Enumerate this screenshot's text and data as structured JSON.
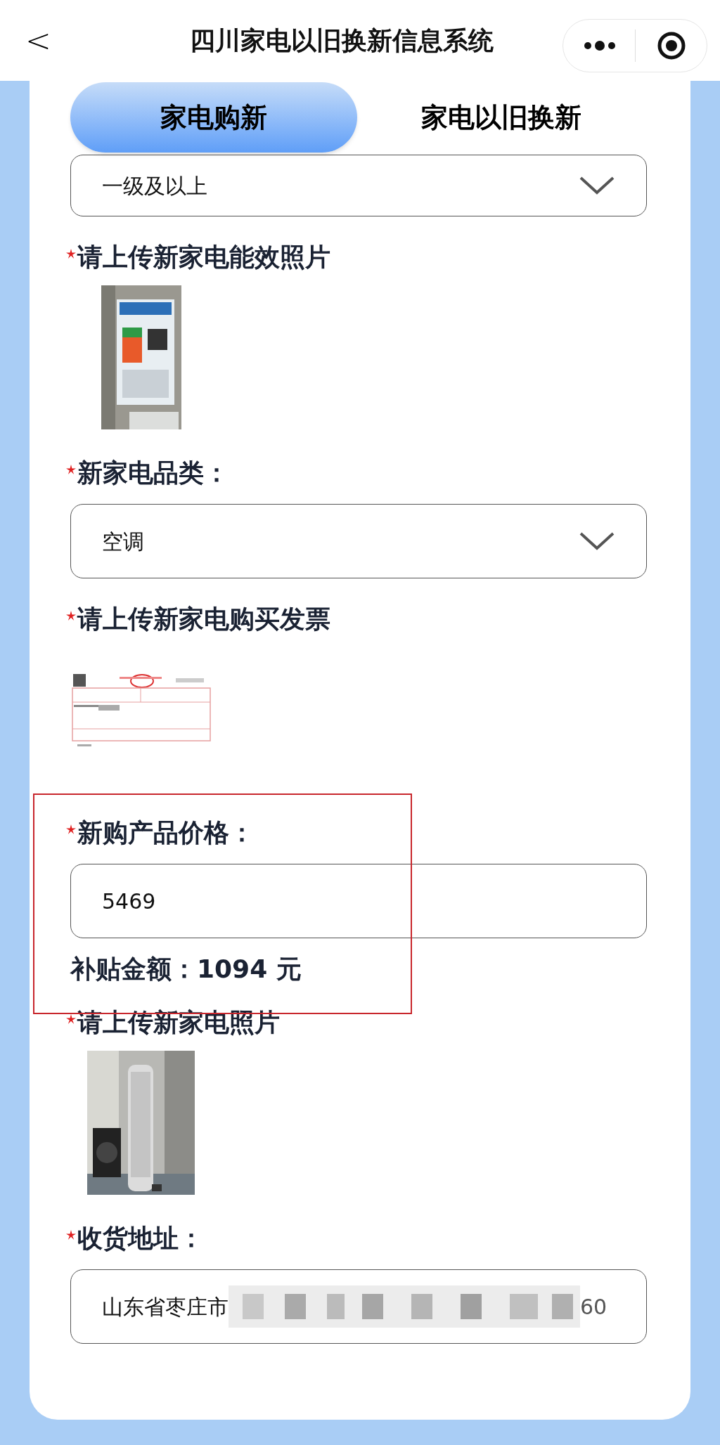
{
  "header": {
    "back": "<",
    "title": "四川家电以旧换新信息系统"
  },
  "tabs": [
    {
      "label": "家电购新",
      "selected": true
    },
    {
      "label": "家电以旧换新",
      "selected": false
    }
  ],
  "fields": [
    {
      "kind": "select",
      "value": "一级及以上"
    },
    {
      "required": true,
      "label": "请上传新家电能效照片"
    },
    {
      "kind": "select",
      "required": true,
      "label": "新家电品类：",
      "value": "空调"
    },
    {
      "required": true,
      "label": "请上传新家电购买发票"
    },
    {
      "kind": "price",
      "required": true,
      "label": "新购产品价格：",
      "value": "5469",
      "subsidy": "补贴金额：1094 元",
      "highlighted": true
    },
    {
      "required": true,
      "label": "请上传新家电照片"
    },
    {
      "kind": "address",
      "required": true,
      "label": "收货地址：",
      "value": "山东省枣庄市",
      "tail": "60"
    }
  ]
}
